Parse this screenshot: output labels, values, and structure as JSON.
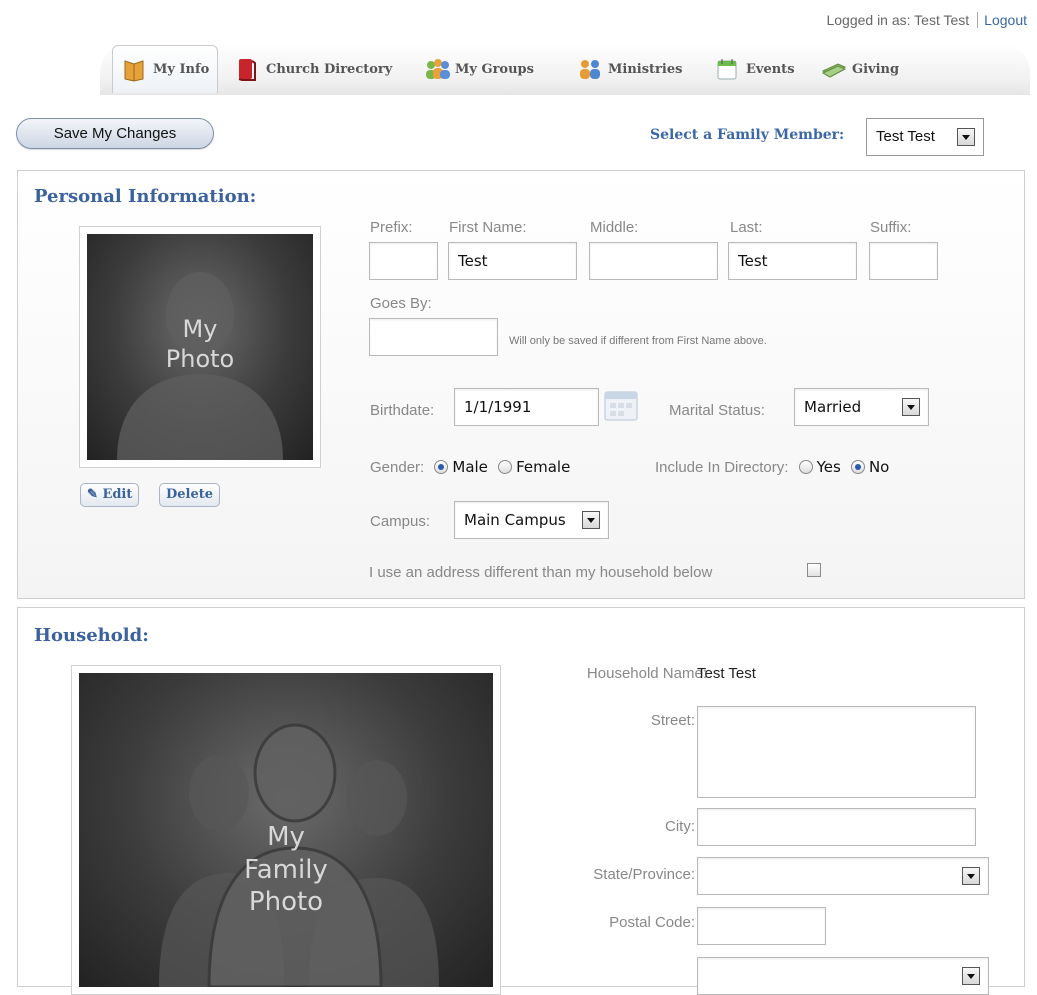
{
  "account": {
    "logged_in_as": "Logged in as: Test Test",
    "logout": "Logout"
  },
  "tabs": [
    {
      "label": "My Info",
      "icon": "book-icon",
      "active": true
    },
    {
      "label": "Church Directory",
      "icon": "red-book-icon"
    },
    {
      "label": "My Groups",
      "icon": "people-group-icon"
    },
    {
      "label": "Ministries",
      "icon": "ministries-people-icon"
    },
    {
      "label": "Events",
      "icon": "calendar-icon"
    },
    {
      "label": "Giving",
      "icon": "money-icon"
    }
  ],
  "toolbar": {
    "save_label": "Save My Changes",
    "family_member_label": "Select a Family Member:",
    "family_member_value": "Test Test"
  },
  "personal": {
    "title": "Personal Information:",
    "photo_text_line1": "My",
    "photo_text_line2": "Photo",
    "edit_label": "Edit",
    "delete_label": "Delete",
    "prefix_label": "Prefix:",
    "first_label": "First Name:",
    "middle_label": "Middle:",
    "last_label": "Last:",
    "suffix_label": "Suffix:",
    "prefix_value": "",
    "first_value": "Test",
    "middle_value": "",
    "last_value": "Test",
    "suffix_value": "",
    "goes_by_label": "Goes By:",
    "goes_by_value": "",
    "goes_by_note": "Will only be saved if different from First Name above.",
    "birthdate_label": "Birthdate:",
    "birthdate_value": "1/1/1991",
    "marital_label": "Marital Status:",
    "marital_value": "Married",
    "gender_label": "Gender:",
    "gender_male": "Male",
    "gender_female": "Female",
    "gender_selected": "Male",
    "directory_label": "Include In Directory:",
    "directory_yes": "Yes",
    "directory_no": "No",
    "directory_selected": "No",
    "campus_label": "Campus:",
    "campus_value": "Main Campus",
    "address_diff_label": "I use an address different than my household below",
    "address_diff_checked": false
  },
  "household": {
    "title": "Household:",
    "photo_text_line1": "My",
    "photo_text_line2": "Family",
    "photo_text_line3": "Photo",
    "name_label": "Household Name:",
    "name_value": "Test Test",
    "street_label": "Street:",
    "street_value": "",
    "city_label": "City:",
    "city_value": "",
    "state_label": "State/Province:",
    "state_value": "",
    "postal_label": "Postal Code:",
    "postal_value": ""
  },
  "colors": {
    "accent": "#3b629e",
    "link": "#3a67a8",
    "photo_bg": "#3c3c3c"
  }
}
